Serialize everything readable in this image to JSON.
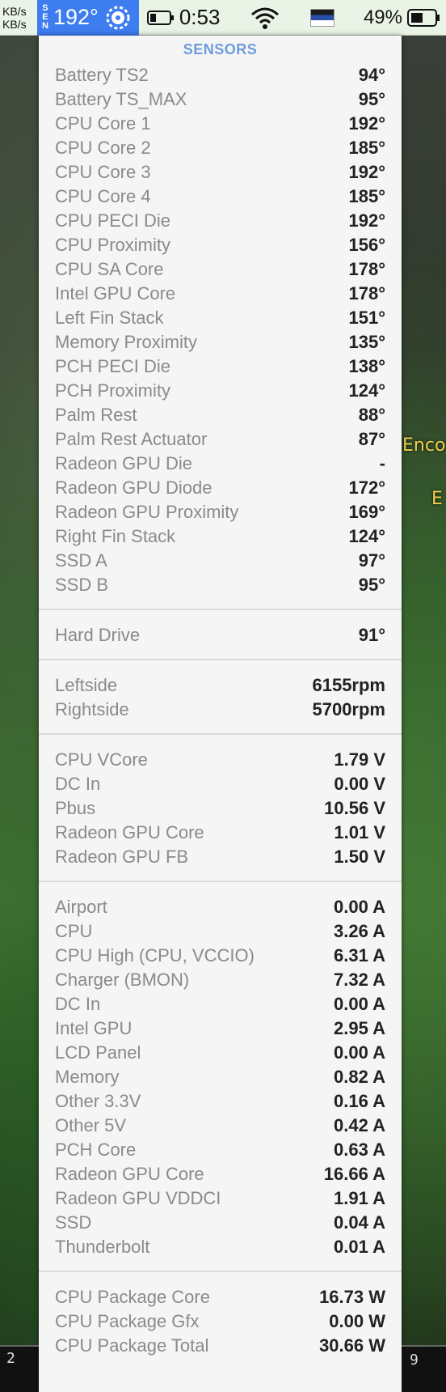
{
  "statusbar": {
    "net_up": "KB/s",
    "net_down": "KB/s",
    "sen_letters": [
      "S",
      "E",
      "N"
    ],
    "sen_temp": "192°",
    "clock": "0:53",
    "battery_pct": "49%",
    "accent_color": "#3d7df0"
  },
  "panel": {
    "title": "SENSORS",
    "sections": [
      {
        "rows": [
          {
            "label": "Battery TS2",
            "value": "94°"
          },
          {
            "label": "Battery TS_MAX",
            "value": "95°"
          },
          {
            "label": "CPU Core 1",
            "value": "192°"
          },
          {
            "label": "CPU Core 2",
            "value": "185°"
          },
          {
            "label": "CPU Core 3",
            "value": "192°"
          },
          {
            "label": "CPU Core 4",
            "value": "185°"
          },
          {
            "label": "CPU PECI Die",
            "value": "192°"
          },
          {
            "label": "CPU Proximity",
            "value": "156°"
          },
          {
            "label": "CPU SA Core",
            "value": "178°"
          },
          {
            "label": "Intel GPU Core",
            "value": "178°"
          },
          {
            "label": "Left Fin Stack",
            "value": "151°"
          },
          {
            "label": "Memory Proximity",
            "value": "135°"
          },
          {
            "label": "PCH PECI Die",
            "value": "138°"
          },
          {
            "label": "PCH Proximity",
            "value": "124°"
          },
          {
            "label": "Palm Rest",
            "value": "88°"
          },
          {
            "label": "Palm Rest Actuator",
            "value": "87°"
          },
          {
            "label": "Radeon GPU Die",
            "value": "-"
          },
          {
            "label": "Radeon GPU Diode",
            "value": "172°"
          },
          {
            "label": "Radeon GPU Proximity",
            "value": "169°"
          },
          {
            "label": "Right Fin Stack",
            "value": "124°"
          },
          {
            "label": "SSD A",
            "value": "97°"
          },
          {
            "label": "SSD B",
            "value": "95°"
          }
        ]
      },
      {
        "rows": [
          {
            "label": "Hard Drive",
            "value": "91°"
          }
        ]
      },
      {
        "rows": [
          {
            "label": "Leftside",
            "value": "6155rpm"
          },
          {
            "label": "Rightside",
            "value": "5700rpm"
          }
        ]
      },
      {
        "rows": [
          {
            "label": "CPU VCore",
            "value": "1.79 V"
          },
          {
            "label": "DC In",
            "value": "0.00 V"
          },
          {
            "label": "Pbus",
            "value": "10.56 V"
          },
          {
            "label": "Radeon GPU Core",
            "value": "1.01 V"
          },
          {
            "label": "Radeon GPU FB",
            "value": "1.50 V"
          }
        ]
      },
      {
        "rows": [
          {
            "label": "Airport",
            "value": "0.00 A"
          },
          {
            "label": "CPU",
            "value": "3.26 A"
          },
          {
            "label": "CPU High (CPU, VCCIO)",
            "value": "6.31 A"
          },
          {
            "label": "Charger (BMON)",
            "value": "7.32 A"
          },
          {
            "label": "DC In",
            "value": "0.00 A"
          },
          {
            "label": "Intel GPU",
            "value": "2.95 A"
          },
          {
            "label": "LCD Panel",
            "value": "0.00 A"
          },
          {
            "label": "Memory",
            "value": "0.82 A"
          },
          {
            "label": "Other 3.3V",
            "value": "0.16 A"
          },
          {
            "label": "Other 5V",
            "value": "0.42 A"
          },
          {
            "label": "PCH Core",
            "value": "0.63 A"
          },
          {
            "label": "Radeon GPU Core",
            "value": "16.66 A"
          },
          {
            "label": "Radeon GPU VDDCI",
            "value": "1.91 A"
          },
          {
            "label": "SSD",
            "value": "0.04 A"
          },
          {
            "label": "Thunderbolt",
            "value": "0.01 A"
          }
        ]
      },
      {
        "rows": [
          {
            "label": "CPU Package Core",
            "value": "16.73 W"
          },
          {
            "label": "CPU Package Gfx",
            "value": "0.00 W"
          },
          {
            "label": "CPU Package Total",
            "value": "30.66 W"
          }
        ]
      }
    ]
  },
  "background": {
    "game_text_1": "Enco",
    "game_text_2": "E",
    "dock_left_num": "2",
    "dock_right_num": "9"
  }
}
